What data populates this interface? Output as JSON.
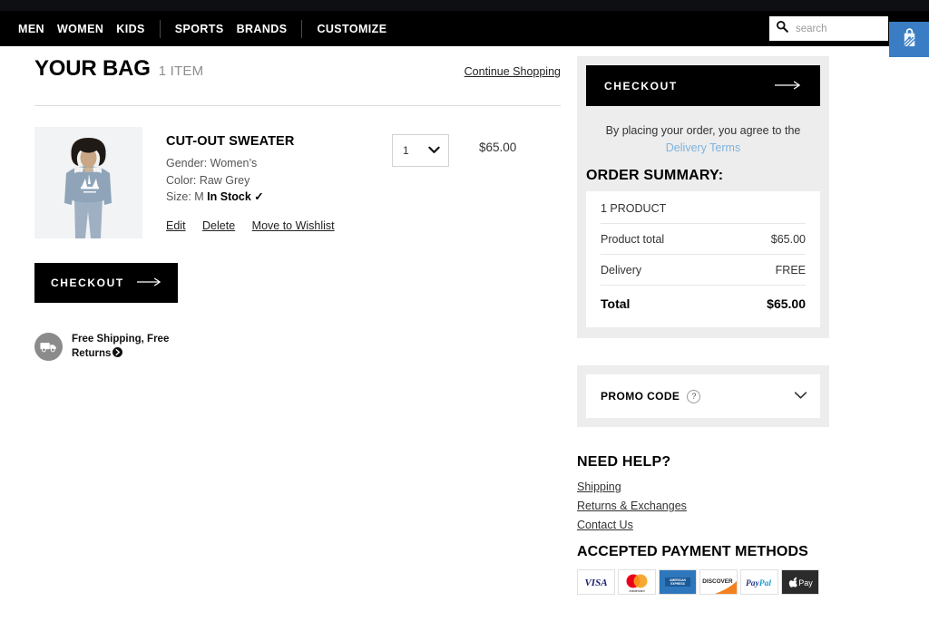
{
  "nav": {
    "groups": [
      {
        "items": [
          {
            "label": "MEN",
            "name": "nav-link-men"
          },
          {
            "label": "WOMEN",
            "name": "nav-link-women"
          },
          {
            "label": "KIDS",
            "name": "nav-link-kids"
          }
        ]
      },
      {
        "items": [
          {
            "label": "SPORTS",
            "name": "nav-link-sports"
          },
          {
            "label": "BRANDS",
            "name": "nav-link-brands"
          }
        ]
      },
      {
        "items": [
          {
            "label": "CUSTOMIZE",
            "name": "nav-link-customize"
          }
        ]
      }
    ],
    "search": {
      "placeholder": "search",
      "value": "",
      "icon": "search-icon"
    },
    "bag_icon": "shopping-bag-icon",
    "bag_button_color": "#3a7dc4"
  },
  "bag": {
    "title": "YOUR BAG",
    "count": "1 ITEM",
    "continue_shopping": "Continue Shopping"
  },
  "product": {
    "name": "CUT-OUT SWEATER",
    "gender": "Gender: Women’s",
    "color": "Color: Raw Grey",
    "size_prefix": "Size: M",
    "stock": "In Stock",
    "stock_check": "✓",
    "links": [
      {
        "label": "Edit",
        "name": "edit-link"
      },
      {
        "label": "Delete",
        "name": "delete-link"
      },
      {
        "label": "Move to Wishlist",
        "name": "move-to-wishlist-link"
      }
    ],
    "quantity": "1",
    "price": "$65.00",
    "image_alt": "woman wearing blue-grey trefoil sweater"
  },
  "left_checkout": {
    "label": "CHECKOUT",
    "arrow": "⟶"
  },
  "shipping_badge": {
    "text": "Free Shipping, Free Returns",
    "icon": "truck-icon",
    "chevron": "❯"
  },
  "sidebar": {
    "checkout": {
      "label": "CHECKOUT",
      "arrow": "⟶"
    },
    "agree_prefix": "By placing your order, you agree to the ",
    "agree_link": "Delivery Terms",
    "agree_link_color": "#7eb3e0",
    "summary_title": "ORDER SUMMARY:",
    "summary": {
      "product_count": "1 PRODUCT",
      "rows": [
        {
          "label": "Product total",
          "value": "$65.00"
        },
        {
          "label": "Delivery",
          "value": "FREE"
        }
      ],
      "total_label": "Total",
      "total_value": "$65.00"
    },
    "promo": {
      "label": "PROMO CODE",
      "help_icon": "question-mark-icon",
      "help_glyph": "?",
      "chevron": "chevron-down-icon"
    },
    "help_title": "NEED HELP?",
    "help_links": [
      {
        "label": "Shipping",
        "name": "help-link-shipping"
      },
      {
        "label": "Returns & Exchanges",
        "name": "help-link-returns-exchanges"
      },
      {
        "label": "Contact Us",
        "name": "help-link-contact-us"
      }
    ],
    "payment_title": "ACCEPTED PAYMENT METHODS",
    "payment_methods": [
      {
        "name": "visa-logo",
        "label": "VISA"
      },
      {
        "name": "mastercard-logo",
        "label": "mastercard"
      },
      {
        "name": "amex-logo",
        "label": "AMERICAN EXPRESS"
      },
      {
        "name": "discover-logo",
        "label": "DISCOVER"
      },
      {
        "name": "paypal-logo",
        "label": "PayPal"
      },
      {
        "name": "apple-pay-logo",
        "label": "Pay"
      }
    ]
  }
}
